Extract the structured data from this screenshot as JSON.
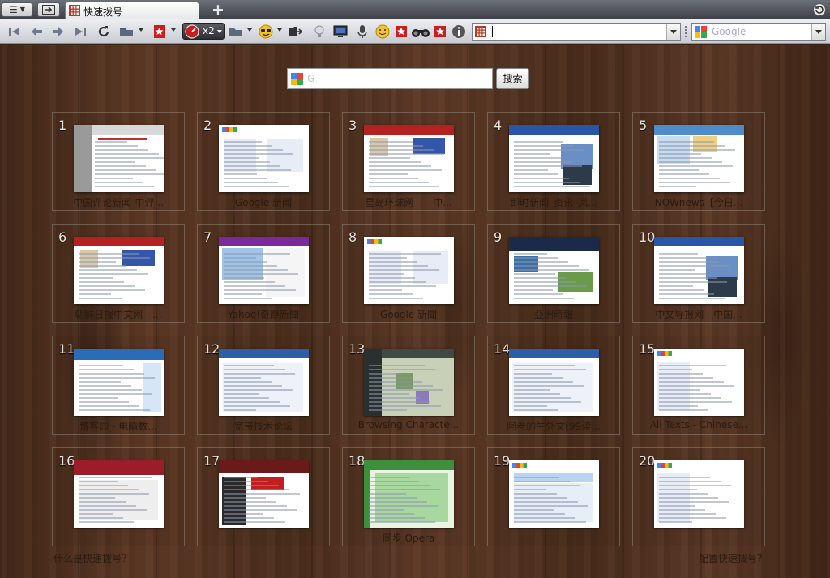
{
  "window": {
    "tab_title": "快速拨号"
  },
  "toolbar": {
    "zoom_label": "x2",
    "search_engine_placeholder": "Google"
  },
  "speed_dial": {
    "search_placeholder": "G",
    "search_button_label": "搜索",
    "tiles": [
      {
        "n": "1",
        "caption": "中国评论新闻-中评...",
        "theme": "gray-sidebar"
      },
      {
        "n": "2",
        "caption": "Google 新闻",
        "theme": "google-news"
      },
      {
        "n": "3",
        "caption": "星岛环球网——中...",
        "theme": "red-news"
      },
      {
        "n": "4",
        "caption": "即时新闻_资讯_凤...",
        "theme": "blue-news"
      },
      {
        "n": "5",
        "caption": "NOWnews【今日...",
        "theme": "light-news"
      },
      {
        "n": "6",
        "caption": "朝鲜日报中文网—...",
        "theme": "red-news"
      },
      {
        "n": "7",
        "caption": "Yahoo!奇摩新聞",
        "theme": "yahoo"
      },
      {
        "n": "8",
        "caption": "Google 新聞",
        "theme": "google-news"
      },
      {
        "n": "9",
        "caption": "亞洲時報",
        "theme": "dark-banner"
      },
      {
        "n": "10",
        "caption": "中文导报网 - 中国...",
        "theme": "blue-news"
      },
      {
        "n": "11",
        "caption": "博客园 - 电脑数...",
        "theme": "blue-forum"
      },
      {
        "n": "12",
        "caption": "宽带技术论坛",
        "theme": "forum"
      },
      {
        "n": "13",
        "caption": "Browsing Characte...",
        "theme": "green-dark"
      },
      {
        "n": "14",
        "caption": "阿老的生外文[99读...",
        "theme": "forum"
      },
      {
        "n": "15",
        "caption": "All Texts - Chinese...",
        "theme": "text-page"
      },
      {
        "n": "16",
        "caption": "",
        "theme": "red-banner"
      },
      {
        "n": "17",
        "caption": "",
        "theme": "maroon"
      },
      {
        "n": "18",
        "caption": "同步 Opera",
        "theme": "green-light"
      },
      {
        "n": "19",
        "caption": "",
        "theme": "igoogle"
      },
      {
        "n": "20",
        "caption": "",
        "theme": "text-page"
      }
    ],
    "footer_left": "什么是快速拨号？",
    "footer_right": "配置快速拨号？"
  },
  "colors": {
    "accent_red": "#cc2222",
    "google_blue": "#3b6fd6",
    "wood_dark": "#3d2416"
  }
}
